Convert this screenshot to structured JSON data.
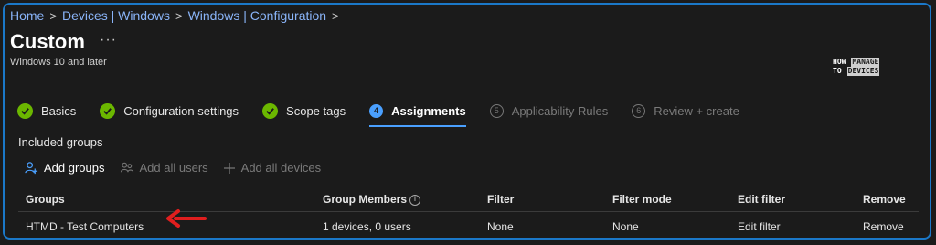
{
  "breadcrumb": [
    "Home",
    "Devices | Windows",
    "Windows | Configuration"
  ],
  "page": {
    "title": "Custom",
    "more": "···",
    "subtitle": "Windows 10 and later"
  },
  "logo": {
    "line1a": "HOW",
    "line1b": "MANAGE",
    "line2a": "TO",
    "line2b": "DEVICES"
  },
  "steps": [
    {
      "label": "Basics",
      "state": "done"
    },
    {
      "label": "Configuration settings",
      "state": "done"
    },
    {
      "label": "Scope tags",
      "state": "done"
    },
    {
      "label": "Assignments",
      "state": "current",
      "num": "4"
    },
    {
      "label": "Applicability Rules",
      "state": "disabled",
      "num": "5"
    },
    {
      "label": "Review + create",
      "state": "disabled",
      "num": "6"
    }
  ],
  "included_groups": "Included groups",
  "actions": {
    "add_groups": "Add groups",
    "add_all_users": "Add all users",
    "add_all_devices": "Add all devices"
  },
  "table": {
    "headers": {
      "groups": "Groups",
      "members": "Group Members",
      "filter": "Filter",
      "filter_mode": "Filter mode",
      "edit_filter": "Edit filter",
      "remove": "Remove"
    },
    "rows": [
      {
        "group": "HTMD - Test Computers",
        "members": "1 devices, 0 users",
        "filter": "None",
        "filter_mode": "None",
        "edit_filter": "Edit filter",
        "remove": "Remove"
      }
    ]
  },
  "colors": {
    "accent": "#4aa0ff",
    "done": "#6bb700",
    "annotation_arrow": "#e01e1e",
    "frame": "#1b78c8"
  }
}
